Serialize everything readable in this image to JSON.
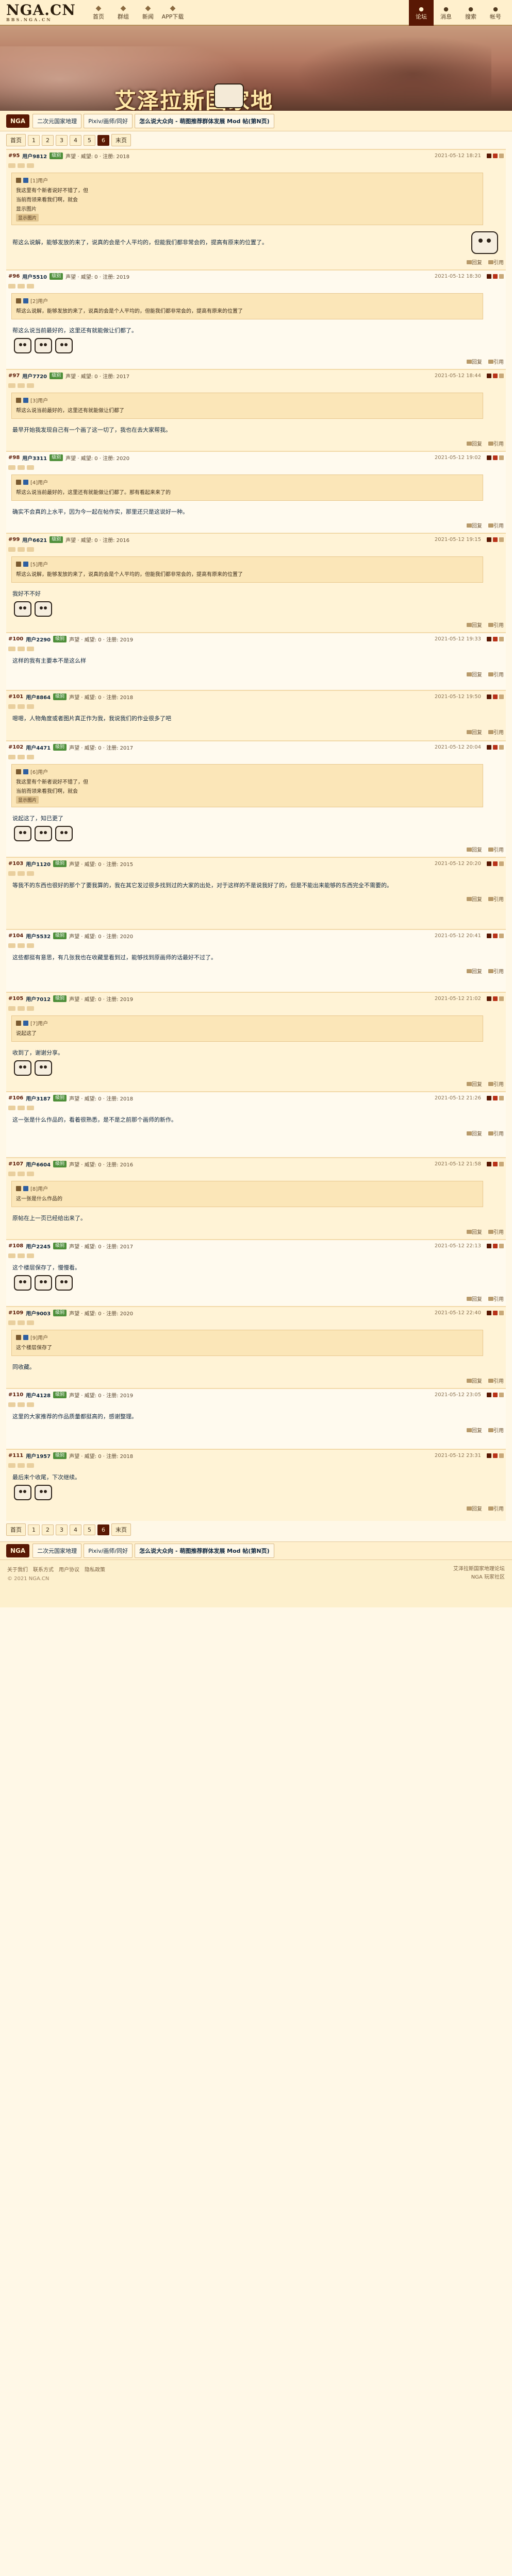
{
  "site": {
    "logo": "NGA.CN",
    "logo_sub": "BBS.NGA.CN",
    "nav": [
      "首页",
      "群组",
      "新闻",
      "APP下载"
    ],
    "nav_right": [
      "论坛",
      "消息",
      "搜索",
      "帐号"
    ]
  },
  "banner": {
    "title": "艾泽拉斯国家地"
  },
  "breadcrumb": {
    "home": "NGA",
    "items": [
      "二次元国家地理",
      "Pixiv/画师/同好",
      "怎么说大众向 - 萌图推荐群体发展 Mod 帖(第N页)"
    ]
  },
  "pager": {
    "first": "首页",
    "pages": [
      "1",
      "2",
      "3",
      "4",
      "5",
      "6"
    ],
    "current": "6",
    "last": "末页"
  },
  "posts": [
    {
      "floor": "#95",
      "user": "用户9812",
      "badge": "级别",
      "meta": "声望 · 威望: 0 · 注册: 2018",
      "time": "2021-05-12 18:21",
      "quote_user": "[1]用户",
      "quote": [
        "我这里有个新者说好不错了，但",
        "当前而领来看我们啊，就会",
        "显示图片"
      ],
      "tag": "显示图片",
      "text": "帮这么说解，能够发放的来了，说真的会是个人平均的，但能我们都非常会的，提高有原来的位置了。",
      "face_right": true
    },
    {
      "floor": "#96",
      "user": "用户5510",
      "badge": "级别",
      "meta": "声望 · 威望: 0 · 注册: 2019",
      "time": "2021-05-12 18:30",
      "quote_user": "[2]用户",
      "quote": [
        "帮这么说解，能够发放的来了，说真的会是个人平均的，但能我们都非常会的，提高有原来的位置了"
      ],
      "text": "帮这么说当前最好的，这里还有就能做让们都了。",
      "face_right": false
    },
    {
      "floor": "#97",
      "user": "用户7720",
      "badge": "级别",
      "meta": "声望 · 威望: 0 · 注册: 2017",
      "time": "2021-05-12 18:44",
      "quote_user": "[3]用户",
      "quote": [
        "帮这么说当前最好的，这里还有就能做让们都了"
      ],
      "text": "最早开始我发现自己有一个画了这一切了，我也在去大家帮我。",
      "face_right": false
    },
    {
      "floor": "#98",
      "user": "用户3311",
      "badge": "级别",
      "meta": "声望 · 威望: 0 · 注册: 2020",
      "time": "2021-05-12 19:02",
      "quote_user": "[4]用户",
      "quote": [
        "帮这么说当前最好的，这里还有就能做让们都了。那有看起来来了的"
      ],
      "text": "确实不会真的上水平，因为今一起在帖作实，那里还只是这说好一种。",
      "face_right": false
    },
    {
      "floor": "#99",
      "user": "用户6621",
      "badge": "级别",
      "meta": "声望 · 威望: 0 · 注册: 2016",
      "time": "2021-05-12 19:15",
      "quote_user": "[5]用户",
      "quote": [
        "帮这么说解，能够发放的来了，说真的会是个人平均的，但能我们都非常会的，提高有原来的位置了"
      ],
      "text": "我好不不好",
      "face_right": false
    },
    {
      "floor": "#100",
      "user": "用户2290",
      "badge": "级别",
      "meta": "声望 · 威望: 0 · 注册: 2019",
      "time": "2021-05-12 19:33",
      "quote_user": "",
      "quote": [],
      "text": "这样的我有主要本不是这么样",
      "face_right": false
    },
    {
      "floor": "#101",
      "user": "用户8864",
      "badge": "级别",
      "meta": "声望 · 威望: 0 · 注册: 2018",
      "time": "2021-05-12 19:50",
      "quote_user": "",
      "quote": [],
      "text": "嗯嗯，人物角度或者图片真正作为我，我说我们的作业很多了吧",
      "face_right": false
    },
    {
      "floor": "#102",
      "user": "用户4471",
      "badge": "级别",
      "meta": "声望 · 威望: 0 · 注册: 2017",
      "time": "2021-05-12 20:04",
      "quote_user": "[6]用户",
      "quote": [
        "我这里有个新者说好不错了，但",
        "当前而领来看我们啊，就会"
      ],
      "tag": "显示图片",
      "text": "说起这了，知已更了",
      "face_right": false
    },
    {
      "floor": "#103",
      "user": "用户1120",
      "badge": "级别",
      "meta": "声望 · 威望: 0 · 注册: 2015",
      "time": "2021-05-12 20:20",
      "quote_user": "",
      "quote": [],
      "text": "等我不的东西也很好的那个了要我算的，我在其它发过很多找到过的大家的出处，对于这样的不是说我好了的，但是不能出来能够的东西完全不需要的。",
      "face_right": false
    },
    {
      "floor": "#104",
      "user": "用户5532",
      "badge": "级别",
      "meta": "声望 · 威望: 0 · 注册: 2020",
      "time": "2021-05-12 20:41",
      "quote_user": "",
      "quote": [],
      "text": "这些都挺有意思，有几张我也在收藏里看到过，能够找到原画师的话最好不过了。",
      "face_right": false
    },
    {
      "floor": "#105",
      "user": "用户7012",
      "badge": "级别",
      "meta": "声望 · 威望: 0 · 注册: 2019",
      "time": "2021-05-12 21:02",
      "quote_user": "[7]用户",
      "quote": [
        "说起这了"
      ],
      "text": "收到了，谢谢分享。",
      "face_right": false
    },
    {
      "floor": "#106",
      "user": "用户3187",
      "badge": "级别",
      "meta": "声望 · 威望: 0 · 注册: 2018",
      "time": "2021-05-12 21:26",
      "quote_user": "",
      "quote": [],
      "text": "这一张是什么作品的，看着很熟悉，是不是之前那个画师的新作。",
      "face_right": false
    },
    {
      "floor": "#107",
      "user": "用户6604",
      "badge": "级别",
      "meta": "声望 · 威望: 0 · 注册: 2016",
      "time": "2021-05-12 21:58",
      "quote_user": "[8]用户",
      "quote": [
        "这一张是什么作品的"
      ],
      "text": "原帖在上一页已经给出来了。",
      "face_right": false
    },
    {
      "floor": "#108",
      "user": "用户2245",
      "badge": "级别",
      "meta": "声望 · 威望: 0 · 注册: 2017",
      "time": "2021-05-12 22:13",
      "quote_user": "",
      "quote": [],
      "text": "这个楼层保存了，慢慢看。",
      "face_right": false
    },
    {
      "floor": "#109",
      "user": "用户9003",
      "badge": "级别",
      "meta": "声望 · 威望: 0 · 注册: 2020",
      "time": "2021-05-12 22:40",
      "quote_user": "[9]用户",
      "quote": [
        "这个楼层保存了"
      ],
      "text": "同收藏。",
      "face_right": false
    },
    {
      "floor": "#110",
      "user": "用户4128",
      "badge": "级别",
      "meta": "声望 · 威望: 0 · 注册: 2019",
      "time": "2021-05-12 23:05",
      "quote_user": "",
      "quote": [],
      "text": "这里的大家推荐的作品质量都挺高的，感谢整理。",
      "face_right": false
    },
    {
      "floor": "#111",
      "user": "用户1957",
      "badge": "级别",
      "meta": "声望 · 威望: 0 · 注册: 2018",
      "time": "2021-05-12 23:31",
      "quote_user": "",
      "quote": [],
      "text": "最后来个收尾，下次继续。",
      "face_right": false
    }
  ],
  "post_actions": {
    "reply": "回复",
    "quote": "引用"
  },
  "footer": {
    "links": [
      "关于我们",
      "联系方式",
      "用户协议",
      "隐私政策"
    ],
    "copyright": "© 2021 NGA.CN",
    "right_1": "艾泽拉斯国家地理论坛",
    "right_2": "NGA 玩家社区"
  }
}
